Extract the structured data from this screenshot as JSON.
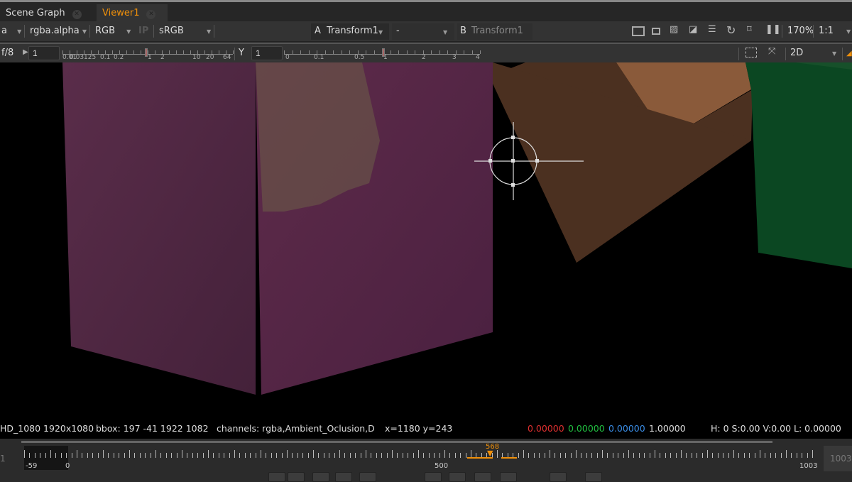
{
  "tabs": [
    {
      "label": "Scene Graph",
      "active": false
    },
    {
      "label": "Viewer1",
      "active": true
    }
  ],
  "toolbar": {
    "channel_set": "a",
    "channel": "rgba.alpha",
    "display": "RGB",
    "ip": "IP",
    "lut": "sRGB",
    "input_a_letter": "A",
    "input_a": "Transform1",
    "compare_mode": "-",
    "input_b_letter": "B",
    "input_b": "Transform1",
    "zoom": "170%",
    "proxy": "1:1"
  },
  "toolbar2": {
    "fstop": "f/8",
    "gain": "1",
    "gain_ticks": [
      "0.01",
      "0.03125",
      "0.1",
      "0.2",
      "1",
      "2",
      "10",
      "20",
      "64"
    ],
    "gamma_label": "Y",
    "gamma": "1",
    "gamma_ticks": [
      "0",
      "0.1",
      "0.5",
      "1",
      "2",
      "3",
      "4"
    ],
    "view_mode": "2D"
  },
  "info": {
    "format": "HD_1080 1920x1080",
    "bbox": "bbox: 197 -41 1922 1082",
    "channels": "channels: rgba,Ambient_Oclusion,D",
    "coords": "x=1180 y=243",
    "r": "0.00000",
    "g": "0.00000",
    "b": "0.00000",
    "a": "1.00000",
    "hsvl": "H:  0 S:0.00 V:0.00  L: 0.00000"
  },
  "colors": {
    "accent": "#f0900a",
    "red": "#e03030",
    "green": "#20c040",
    "blue": "#3a8ee8"
  },
  "timeline": {
    "start_label": "-59",
    "zero_label": "0",
    "mid_label": "500",
    "end_label": "1003",
    "current_frame": "568",
    "in_field": "1",
    "out_field": "1003"
  }
}
